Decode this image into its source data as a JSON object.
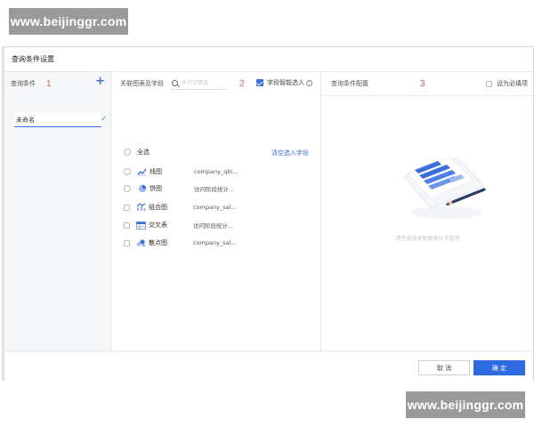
{
  "watermark": {
    "text": "www.beijinggr.com"
  },
  "dialog": {
    "title": "查询条件设置",
    "left": {
      "header": "查询条件",
      "step": "1",
      "add_icon": "plus-icon",
      "items": [
        {
          "label": "未命名",
          "selected": true
        }
      ]
    },
    "middle": {
      "header": "关联图表及字段",
      "search_placeholder": "多行字筛选",
      "step": "2",
      "smart_select": {
        "label": "字段智能选入",
        "checked": true
      },
      "select_all": "全选",
      "clear_link": "清空选入字段",
      "charts": [
        {
          "icon": "line-chart-icon",
          "name": "线图",
          "source": "company_qbi..."
        },
        {
          "icon": "pie-chart-icon",
          "name": "饼图",
          "source": "访问阶段统计..."
        },
        {
          "icon": "combo-chart-icon",
          "name": "组合图",
          "source": "company_sal..."
        },
        {
          "icon": "crosstab-icon",
          "name": "交叉表",
          "source": "访问阶段统计..."
        },
        {
          "icon": "scatter-chart-icon",
          "name": "散点图",
          "source": "company_sal..."
        }
      ]
    },
    "right": {
      "header": "查询条件配置",
      "step": "3",
      "required": {
        "label": "设为必填项",
        "checked": false
      },
      "empty_hint": "请先选择关联图表分字段吧"
    },
    "footer": {
      "cancel": "取 消",
      "ok": "确 定"
    }
  },
  "colors": {
    "accent": "#2d6ae0",
    "step_number": "#e8573a",
    "panel_bg": "#f6f7f9"
  }
}
